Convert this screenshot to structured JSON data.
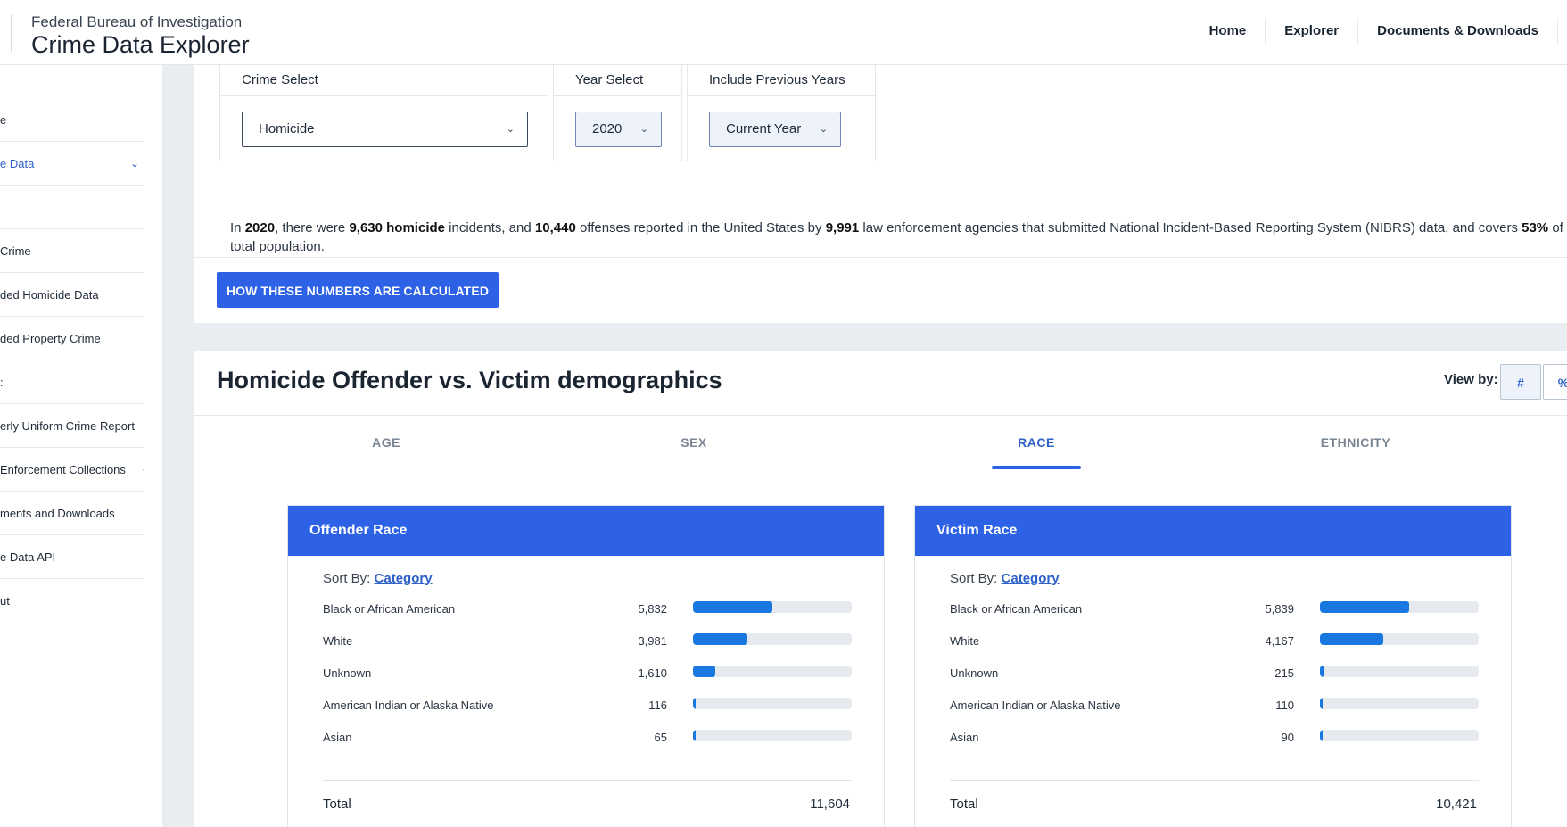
{
  "header": {
    "agency": "Federal Bureau of Investigation",
    "app_title": "Crime Data Explorer",
    "nav": [
      "Home",
      "Explorer",
      "Documents & Downloads"
    ]
  },
  "sidebar": {
    "items": [
      {
        "label": "e",
        "active": false
      },
      {
        "label": "e Data",
        "active": true
      },
      {
        "label": "",
        "active": false
      },
      {
        "label": "Crime",
        "active": false
      },
      {
        "label": "ded Homicide Data",
        "active": false
      },
      {
        "label": "ded Property Crime",
        "active": false
      },
      {
        "label": ":",
        "active": false
      },
      {
        "label": "erly Uniform Crime Report",
        "active": false
      },
      {
        "label": "Enforcement Collections",
        "active": false
      },
      {
        "label": "ments and Downloads",
        "active": false
      },
      {
        "label": "e Data API",
        "active": false
      },
      {
        "label": "ut",
        "active": false
      }
    ]
  },
  "filters": {
    "crime": {
      "label": "Crime Select",
      "value": "Homicide"
    },
    "year": {
      "label": "Year Select",
      "value": "2020"
    },
    "previous": {
      "label": "Include Previous Years",
      "value": "Current Year"
    }
  },
  "summary": {
    "p1": "In ",
    "year": "2020",
    "p2": ", there were ",
    "incidents": "9,630 homicide",
    "p3": " incidents, and ",
    "offenses": "10,440",
    "p4": " offenses reported in the United States by ",
    "agencies": "9,991",
    "p5": " law enforcement agencies that submitted National Incident-Based Reporting System (NIBRS) data, and covers ",
    "coverage": "53%",
    "p6": " of the total population."
  },
  "calc_button": "HOW THESE NUMBERS ARE CALCULATED",
  "demographics": {
    "title": "Homicide Offender vs. Victim demographics",
    "view_by_label": "View by:",
    "view_options": [
      "#",
      "%"
    ],
    "tabs": [
      "AGE",
      "SEX",
      "RACE",
      "ETHNICITY"
    ],
    "active_tab": "RACE",
    "sort_prefix": "Sort By:",
    "sort_value": "Category",
    "total_label": "Total",
    "offender": {
      "title": "Offender Race",
      "rows": [
        {
          "label": "Black or African American",
          "count": "5,832",
          "fraction": 0.5026
        },
        {
          "label": "White",
          "count": "3,981",
          "fraction": 0.3431
        },
        {
          "label": "Unknown",
          "count": "1,610",
          "fraction": 0.1387
        },
        {
          "label": "American Indian or Alaska Native",
          "count": "116",
          "fraction": 0.01
        },
        {
          "label": "Asian",
          "count": "65",
          "fraction": 0.0056
        }
      ],
      "total": "11,604"
    },
    "victim": {
      "title": "Victim Race",
      "rows": [
        {
          "label": "Black or African American",
          "count": "5,839",
          "fraction": 0.5603
        },
        {
          "label": "White",
          "count": "4,167",
          "fraction": 0.3998
        },
        {
          "label": "Unknown",
          "count": "215",
          "fraction": 0.0206
        },
        {
          "label": "American Indian or Alaska Native",
          "count": "110",
          "fraction": 0.0106
        },
        {
          "label": "Asian",
          "count": "90",
          "fraction": 0.0086
        }
      ],
      "total": "10,421"
    }
  },
  "colors": {
    "accent": "#2d62e6",
    "bar": "#1878e0",
    "track": "#e6eaee",
    "link": "#2e62c9"
  }
}
